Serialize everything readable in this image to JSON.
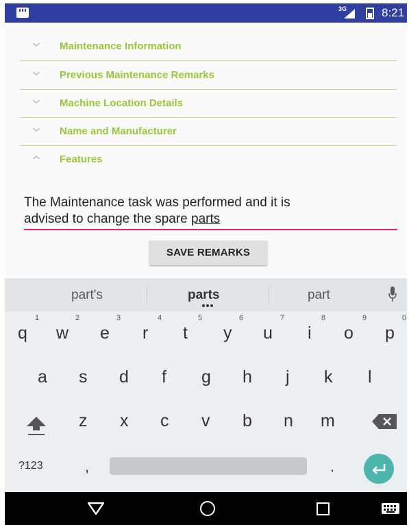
{
  "status_bar": {
    "network": "3G",
    "time": "8:21"
  },
  "sections": [
    {
      "label": "Maintenance Information",
      "expanded": false
    },
    {
      "label": "Previous Maintenance Remarks",
      "expanded": false
    },
    {
      "label": "Machine Location Details",
      "expanded": false
    },
    {
      "label": "Name and Manufacturer",
      "expanded": false
    },
    {
      "label": "Features",
      "expanded": true
    }
  ],
  "remarks": {
    "line1": "The Maintenance task was performed and it is",
    "line2_prefix": "advised to change the spare ",
    "line2_word": "parts"
  },
  "save_button": "SAVE REMARKS",
  "keyboard": {
    "suggestions": [
      "part's",
      "parts",
      "part"
    ],
    "row1": [
      "q",
      "w",
      "e",
      "r",
      "t",
      "y",
      "u",
      "i",
      "o",
      "p"
    ],
    "row1_hints": [
      "1",
      "2",
      "3",
      "4",
      "5",
      "6",
      "7",
      "8",
      "9",
      "0"
    ],
    "row2": [
      "a",
      "s",
      "d",
      "f",
      "g",
      "h",
      "j",
      "k",
      "l"
    ],
    "row3": [
      "z",
      "x",
      "c",
      "v",
      "b",
      "n",
      "m"
    ],
    "symbols_key": "?123",
    "comma": ",",
    "period": "."
  },
  "colors": {
    "status_bar": "#303f9f",
    "section_label": "#9bc53d",
    "section_divider": "#cfdc8e",
    "input_underline": "#e91e63",
    "enter_key": "#4db6ac"
  }
}
